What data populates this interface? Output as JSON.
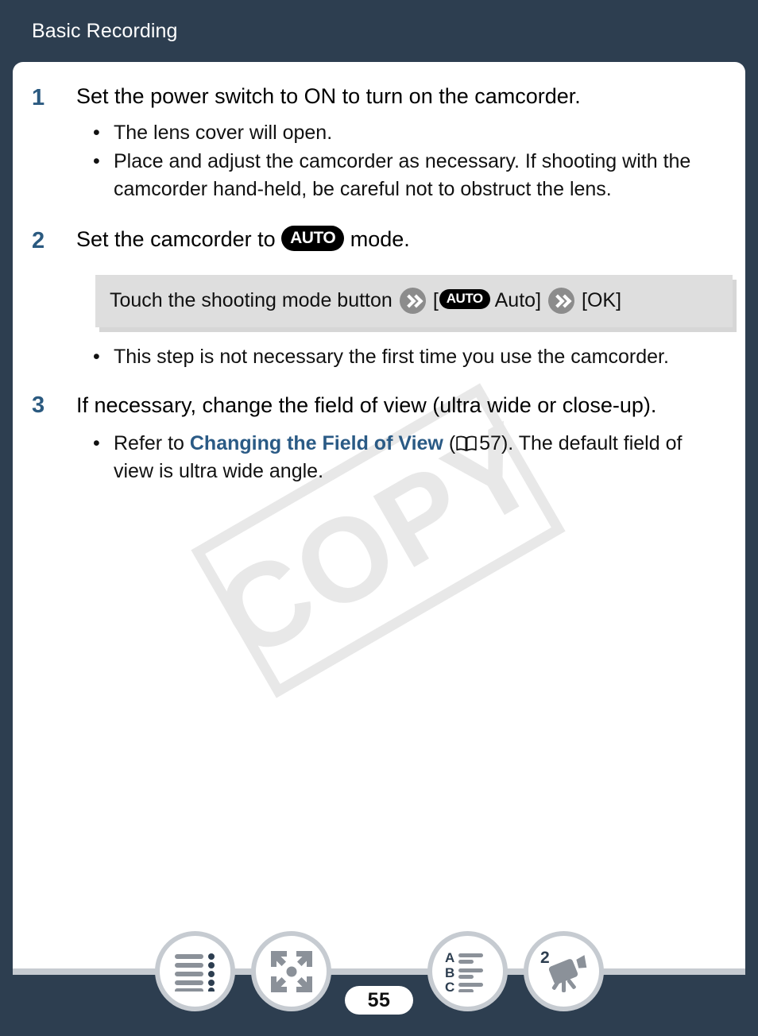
{
  "header": {
    "title": "Basic Recording"
  },
  "colors": {
    "page_background": "#2d3e50",
    "card_background": "#ffffff",
    "step_number": "#2b5a80",
    "link": "#2a5a85",
    "op_box": "#dedede",
    "nav_ring": "#c6cbd1",
    "icon_gray": "#8b9199",
    "icon_navy": "#2d3e50",
    "watermark": "#e8e8e8"
  },
  "watermark": {
    "text": "COPY"
  },
  "steps": [
    {
      "number": "1",
      "title": "Set the power switch to ON to turn on the camcorder.",
      "bullets": [
        "The lens cover will open.",
        "Place and adjust the camcorder as necessary. If shooting with the camcorder hand-held, be careful not to obstruct the lens."
      ]
    },
    {
      "number": "2",
      "title_before_badge": "Set the camcorder to ",
      "badge_label": "AUTO",
      "title_after_badge": " mode.",
      "operation": {
        "text_start": "Touch the shooting mode button",
        "arrow_1_icon": "double-chevron-icon",
        "bracket_open_1": "[",
        "badge_label": "AUTO",
        "option_label": "Auto",
        "bracket_close_1": "]",
        "arrow_2_icon": "double-chevron-icon",
        "ok_label": "[OK]"
      },
      "bullets": [
        "This step is not necessary the first time you use the camcorder."
      ]
    },
    {
      "number": "3",
      "title": "If necessary, change the field of view (ultra wide or close-up).",
      "reference_bullet": {
        "prefix": "Refer to ",
        "link_text": "Changing the Field of View",
        "paren_open": " (",
        "book_icon": "open-book-icon",
        "page_ref": "57",
        "suffix": "). The default field of view is ultra wide angle."
      }
    }
  ],
  "footer": {
    "page_number": "55",
    "nav_items": [
      {
        "name": "table-of-contents",
        "icon": "list-lines-icon"
      },
      {
        "name": "expand-view",
        "icon": "expand-arrows-icon"
      },
      {
        "name": "alphabetical-index",
        "icon": "abc-index-icon",
        "letters": [
          "A",
          "B",
          "C"
        ]
      },
      {
        "name": "chapter-shortcut",
        "icon": "camcorder-icon",
        "badge": "2"
      }
    ]
  }
}
